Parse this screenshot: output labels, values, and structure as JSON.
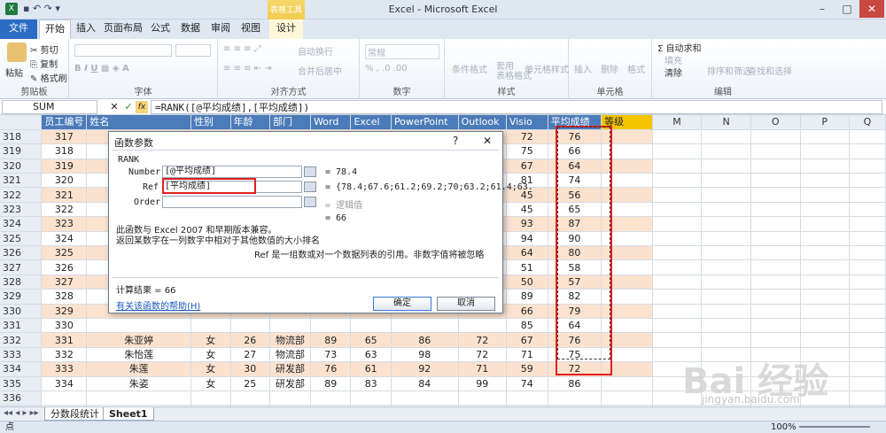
{
  "window": {
    "title": "Excel - Microsoft Excel",
    "context_tab": "表格工具",
    "min": "–",
    "max": "□",
    "close": "✕"
  },
  "tabs": [
    "文件",
    "开始",
    "插入",
    "页面布局",
    "公式",
    "数据",
    "审阅",
    "视图",
    "设计"
  ],
  "ribbon": {
    "clipboard": {
      "label": "剪贴板",
      "paste": "粘贴",
      "cut": "剪切",
      "copy": "复制",
      "format_painter": "格式刷"
    },
    "font": {
      "label": "字体"
    },
    "alignment": {
      "label": "对齐方式",
      "wrap": "自动换行",
      "merge": "合并后居中"
    },
    "number": {
      "label": "数字",
      "format": "常规"
    },
    "styles": {
      "label": "样式",
      "cond": "条件格式",
      "table": "套用\n表格格式",
      "cell": "单元格样式"
    },
    "cells": {
      "label": "单元格",
      "insert": "插入",
      "delete": "删除",
      "format": "格式"
    },
    "editing": {
      "label": "编辑",
      "autosum": "Σ 自动求和",
      "fill": "填充",
      "clear": "清除",
      "sort": "排序和筛选",
      "find": "查找和选择"
    }
  },
  "formula_bar": {
    "name_box": "SUM",
    "cancel": "✕",
    "enter": "✓",
    "fx": "fx",
    "formula": "=RANK([@平均成绩],[平均成绩])"
  },
  "columns": [
    "员工编号",
    "姓名",
    "性别",
    "年龄",
    "部门",
    "Word",
    "Excel",
    "PowerPoint",
    "Outlook",
    "Visio",
    "平均成绩",
    "等级",
    "M",
    "N",
    "O",
    "P",
    "Q"
  ],
  "rows": [
    {
      "r": "318",
      "id": "317",
      "name": "",
      "sex": "",
      "age": "",
      "dept": "",
      "w": "",
      "e": "",
      "p": "",
      "o": "",
      "v": "72",
      "avg": "76"
    },
    {
      "r": "319",
      "id": "318",
      "name": "",
      "sex": "",
      "age": "",
      "dept": "",
      "w": "",
      "e": "",
      "p": "",
      "o": "",
      "v": "75",
      "avg": "66"
    },
    {
      "r": "320",
      "id": "319",
      "name": "",
      "sex": "",
      "age": "",
      "dept": "",
      "w": "",
      "e": "",
      "p": "",
      "o": "",
      "v": "67",
      "avg": "64"
    },
    {
      "r": "321",
      "id": "320",
      "name": "",
      "sex": "",
      "age": "",
      "dept": "",
      "w": "",
      "e": "",
      "p": "",
      "o": "",
      "v": "81",
      "avg": "74"
    },
    {
      "r": "322",
      "id": "321",
      "name": "",
      "sex": "",
      "age": "",
      "dept": "",
      "w": "",
      "e": "",
      "p": "",
      "o": "",
      "v": "45",
      "avg": "56"
    },
    {
      "r": "323",
      "id": "322",
      "name": "",
      "sex": "",
      "age": "",
      "dept": "",
      "w": "",
      "e": "",
      "p": "",
      "o": "",
      "v": "45",
      "avg": "65"
    },
    {
      "r": "324",
      "id": "323",
      "name": "",
      "sex": "",
      "age": "",
      "dept": "",
      "w": "",
      "e": "",
      "p": "",
      "o": "",
      "v": "93",
      "avg": "87"
    },
    {
      "r": "325",
      "id": "324",
      "name": "",
      "sex": "",
      "age": "",
      "dept": "",
      "w": "",
      "e": "",
      "p": "",
      "o": "",
      "v": "94",
      "avg": "90"
    },
    {
      "r": "326",
      "id": "325",
      "name": "",
      "sex": "",
      "age": "",
      "dept": "",
      "w": "",
      "e": "",
      "p": "",
      "o": "",
      "v": "64",
      "avg": "80"
    },
    {
      "r": "327",
      "id": "326",
      "name": "",
      "sex": "",
      "age": "",
      "dept": "",
      "w": "",
      "e": "",
      "p": "",
      "o": "",
      "v": "51",
      "avg": "58"
    },
    {
      "r": "328",
      "id": "327",
      "name": "",
      "sex": "",
      "age": "",
      "dept": "",
      "w": "",
      "e": "",
      "p": "",
      "o": "",
      "v": "50",
      "avg": "57"
    },
    {
      "r": "329",
      "id": "328",
      "name": "",
      "sex": "",
      "age": "",
      "dept": "",
      "w": "",
      "e": "",
      "p": "",
      "o": "",
      "v": "89",
      "avg": "82"
    },
    {
      "r": "330",
      "id": "329",
      "name": "",
      "sex": "",
      "age": "",
      "dept": "",
      "w": "",
      "e": "",
      "p": "",
      "o": "",
      "v": "66",
      "avg": "79"
    },
    {
      "r": "331",
      "id": "330",
      "name": "",
      "sex": "",
      "age": "",
      "dept": "",
      "w": "",
      "e": "",
      "p": "",
      "o": "",
      "v": "85",
      "avg": "64"
    },
    {
      "r": "332",
      "id": "331",
      "name": "朱亚婷",
      "sex": "女",
      "age": "26",
      "dept": "物流部",
      "w": "89",
      "e": "65",
      "p": "86",
      "o": "72",
      "v": "67",
      "avg": "76"
    },
    {
      "r": "333",
      "id": "332",
      "name": "朱怡莲",
      "sex": "女",
      "age": "27",
      "dept": "物流部",
      "w": "73",
      "e": "63",
      "p": "98",
      "o": "72",
      "v": "71",
      "avg": "75"
    },
    {
      "r": "334",
      "id": "333",
      "name": "朱莲",
      "sex": "女",
      "age": "30",
      "dept": "研发部",
      "w": "76",
      "e": "61",
      "p": "92",
      "o": "71",
      "v": "59",
      "avg": "72"
    },
    {
      "r": "335",
      "id": "334",
      "name": "朱姿",
      "sex": "女",
      "age": "25",
      "dept": "研发部",
      "w": "89",
      "e": "83",
      "p": "84",
      "o": "99",
      "v": "74",
      "avg": "86"
    },
    {
      "r": "336",
      "id": "",
      "name": "",
      "sex": "",
      "age": "",
      "dept": "",
      "w": "",
      "e": "",
      "p": "",
      "o": "",
      "v": "",
      "avg": ""
    },
    {
      "r": "337",
      "id": "",
      "name": "",
      "sex": "",
      "age": "",
      "dept": "",
      "w": "",
      "e": "",
      "p": "",
      "o": "",
      "v": "",
      "avg": ""
    },
    {
      "r": "338",
      "id": "",
      "name": "",
      "sex": "",
      "age": "",
      "dept": "",
      "w": "",
      "e": "",
      "p": "",
      "o": "",
      "v": "",
      "avg": ""
    }
  ],
  "dialog": {
    "title": "函数参数",
    "help_q": "?",
    "close": "✕",
    "func": "RANK",
    "args": [
      {
        "label": "Number",
        "value": "[@平均成绩]",
        "result": "= 78.4"
      },
      {
        "label": "Ref",
        "value": "[平均成绩]",
        "result": "= {78.4;67.6;61.2;69.2;70;63.2;61.4;63."
      },
      {
        "label": "Order",
        "value": "",
        "result": "= 逻辑值"
      }
    ],
    "result_line": "= 66",
    "desc1": "此函数与 Excel 2007 和早期版本兼容。",
    "desc2": "返回某数字在一列数字中相对于其他数值的大小排名",
    "ref_desc": "Ref  是一组数或对一个数据列表的引用。非数字值将被忽略",
    "calc": "计算结果 =  66",
    "help_link": "有关该函数的帮助(H)",
    "ok": "确定",
    "cancel": "取消"
  },
  "sheet_tabs": [
    "分数段统计",
    "Sheet1"
  ],
  "status": {
    "mode": "点",
    "zoom": "100%"
  },
  "watermark": {
    "brand": "Bai 经验",
    "url": "jingyan.baidu.com"
  }
}
